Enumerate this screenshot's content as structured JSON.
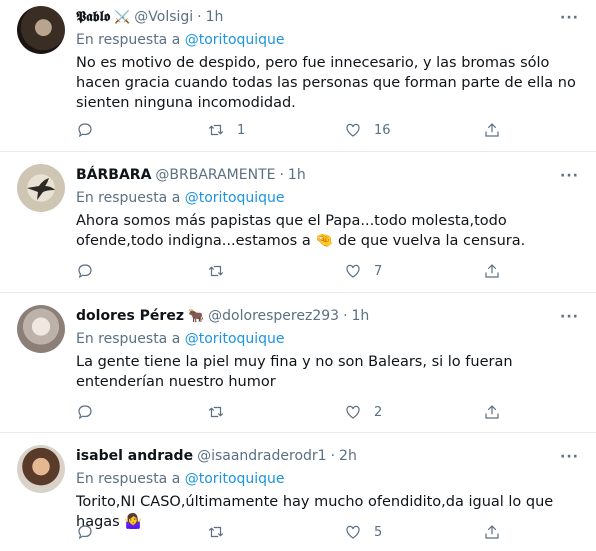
{
  "reply_prefix": "En respuesta a",
  "tweets": [
    {
      "name": "𝕻𝖆𝖇𝖑𝖔",
      "badge": "⚔️",
      "handle": "@Volsigi",
      "dot": "·",
      "time": "1h",
      "reply_to": "@toritoquique",
      "text": "No es motivo de despido, pero fue innecesario, y las bromas sólo hacen gracia cuando todas las personas que forman parte de ella no sienten ninguna incomodidad.",
      "retweets": "1",
      "likes": "16"
    },
    {
      "name": "BÁRBARA",
      "badge": "",
      "handle": "@BRBARAMENTE",
      "dot": "·",
      "time": "1h",
      "reply_to": "@toritoquique",
      "text_before": "Ahora somos más papistas que el Papa...todo molesta,todo ofende,todo indigna...estamos a",
      "text_emoji": "🤏",
      "text_after": " de que vuelva la censura.",
      "retweets": "",
      "likes": "7"
    },
    {
      "name": "dolores Pérez",
      "badge": "🐂",
      "handle": "@doloresperez293",
      "dot": "·",
      "time": "1h",
      "reply_to": "@toritoquique",
      "text": "La gente tiene la piel muy fina y no son Balears, si lo fueran entenderían nuestro humor",
      "retweets": "",
      "likes": "2"
    },
    {
      "name": "isabel andrade",
      "badge": "",
      "handle": "@isaandraderodr1",
      "dot": "·",
      "time": "2h",
      "reply_to": "@toritoquique",
      "text": "Torito,NI CASO,últimamente hay mucho ofendidito,da igual lo que hagas",
      "text_emoji": "🤷‍♀️",
      "retweets": "",
      "likes": "5"
    }
  ],
  "more_label": "···"
}
